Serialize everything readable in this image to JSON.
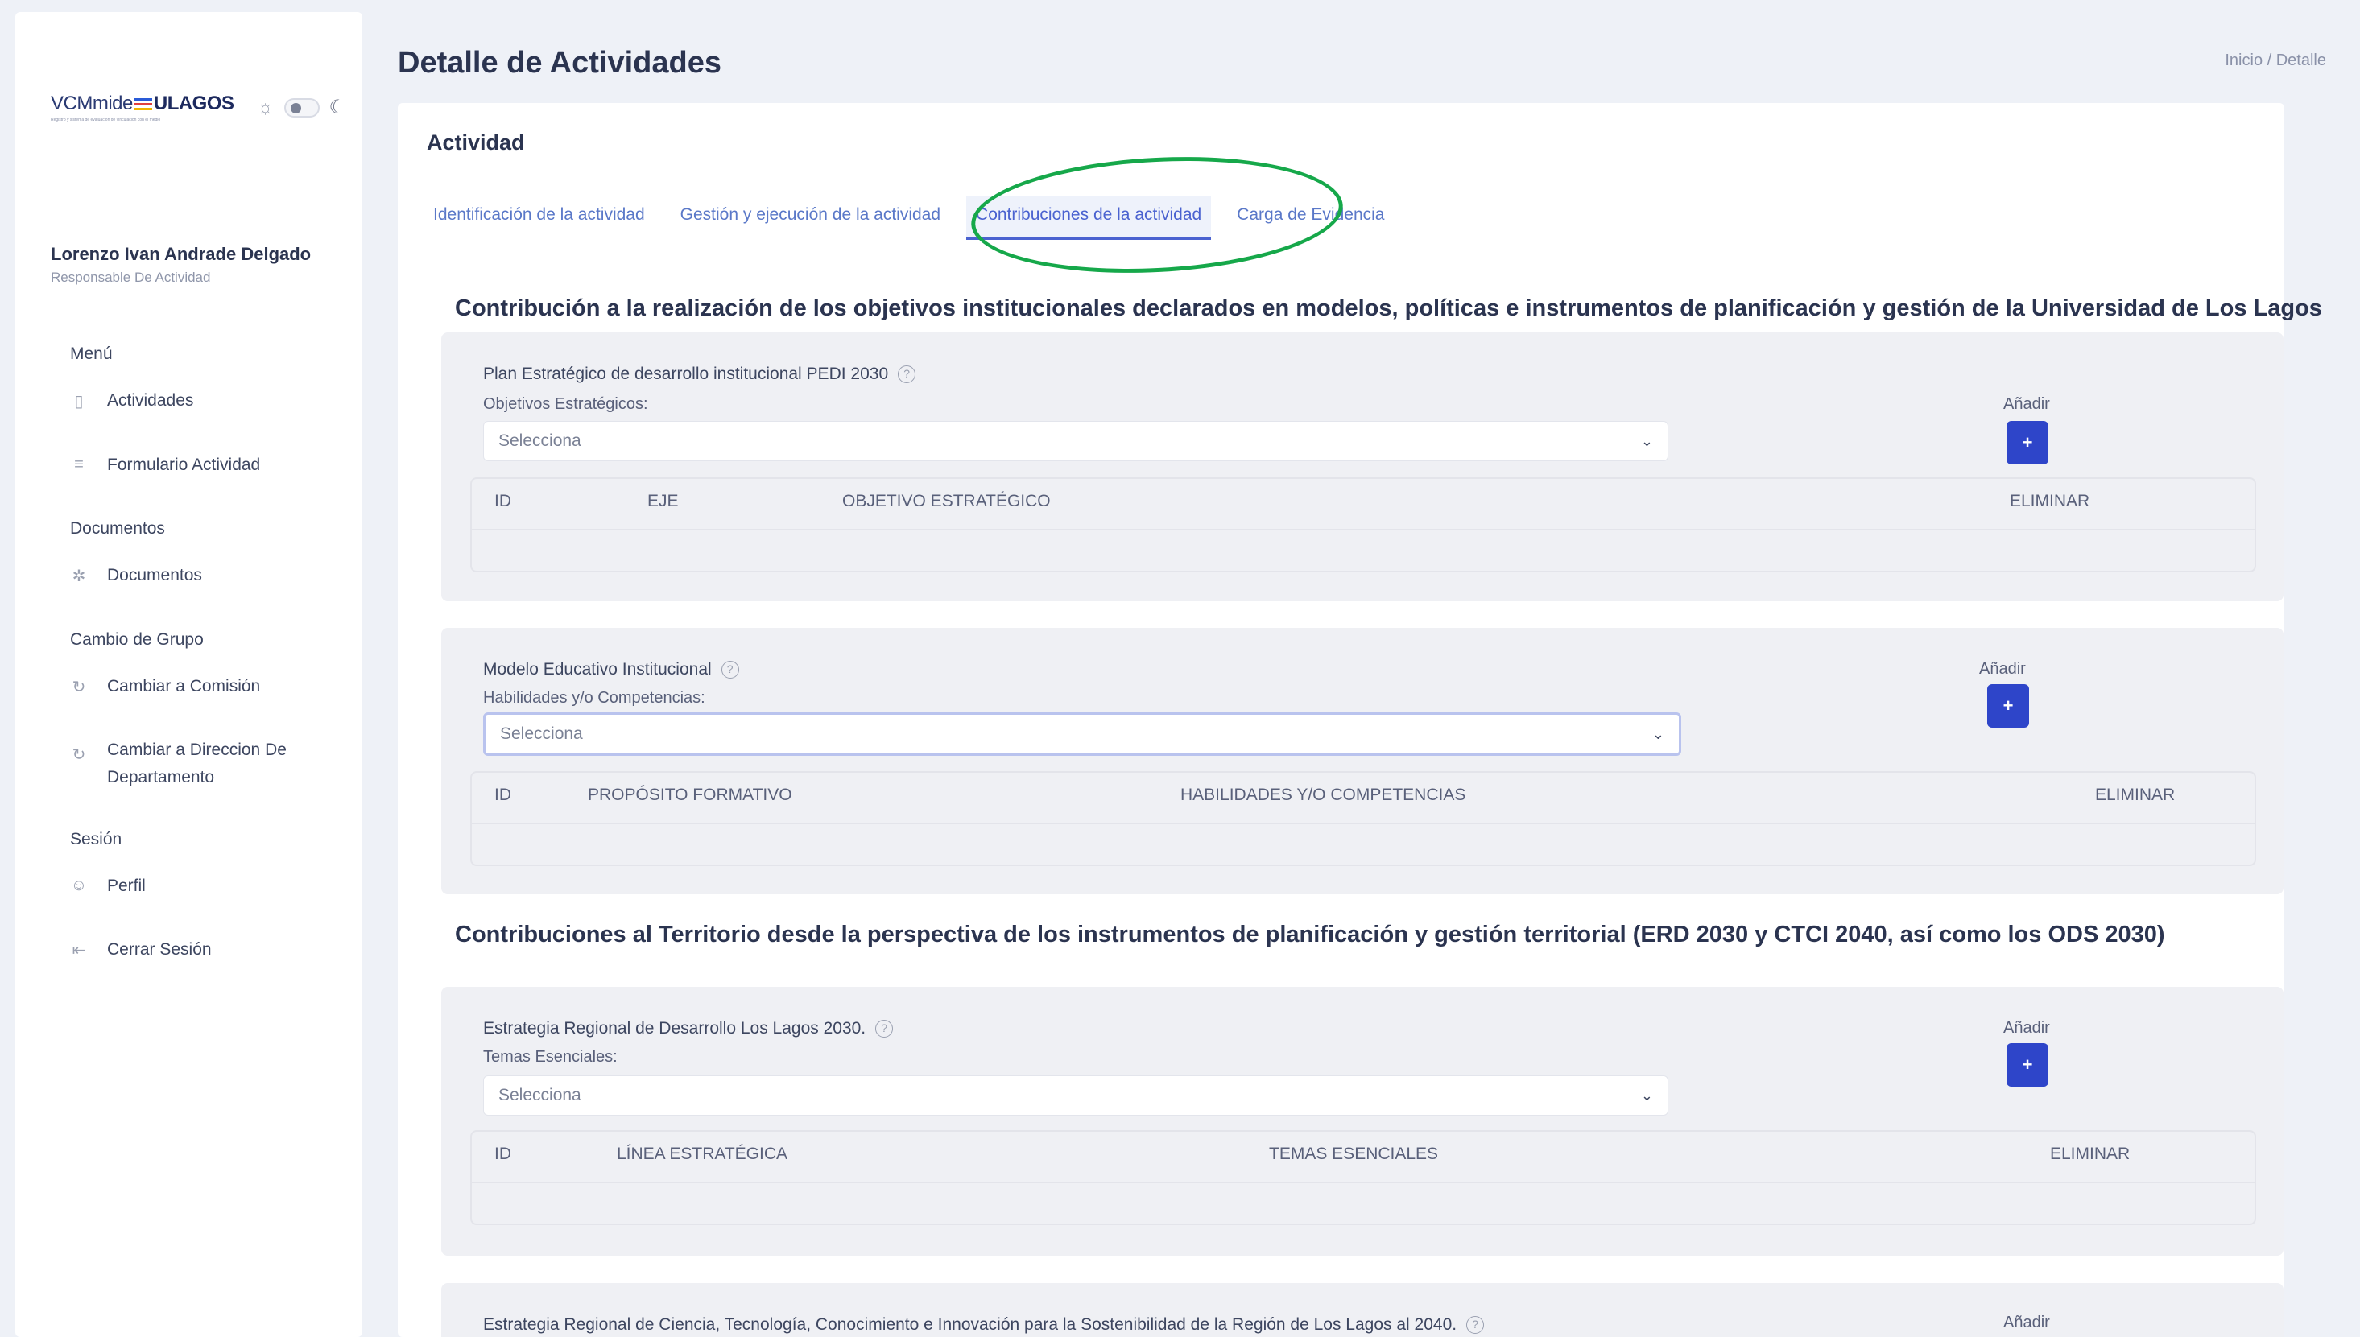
{
  "app": {
    "logo_text": "VCMmide",
    "logo_brand": "ULAGOS",
    "logo_tagline": "Registro y sistema de evaluación de vinculación con el medio"
  },
  "user": {
    "name": "Lorenzo Ivan Andrade Delgado",
    "role": "Responsable De Actividad"
  },
  "sidebar": {
    "sections": [
      {
        "title": "Menú",
        "items": [
          {
            "label": "Actividades",
            "icon": "clipboard-icon"
          },
          {
            "label": "Formulario Actividad",
            "icon": "list-icon"
          }
        ]
      },
      {
        "title": "Documentos",
        "items": [
          {
            "label": "Documentos",
            "icon": "life-ring-icon"
          }
        ]
      },
      {
        "title": "Cambio de Grupo",
        "items": [
          {
            "label": "Cambiar a Comisión",
            "icon": "refresh-icon"
          },
          {
            "label": "Cambiar a Direccion De Departamento",
            "icon": "refresh-icon"
          }
        ]
      },
      {
        "title": "Sesión",
        "items": [
          {
            "label": "Perfil",
            "icon": "user-circle-icon"
          },
          {
            "label": "Cerrar Sesión",
            "icon": "logout-icon"
          }
        ]
      }
    ]
  },
  "header": {
    "title": "Detalle de Actividades",
    "breadcrumb": "Inicio / Detalle"
  },
  "card": {
    "title": "Actividad",
    "tabs": [
      {
        "label": "Identificación de la actividad",
        "active": false
      },
      {
        "label": "Gestión y ejecución de la actividad",
        "active": false
      },
      {
        "label": "Contribuciones de la actividad",
        "active": true
      },
      {
        "label": "Carga de Evidencia",
        "active": false
      }
    ]
  },
  "sections": {
    "institutional_heading": "Contribución a la realización de los objetivos institucionales declarados en modelos, políticas e instrumentos de planificación y gestión de la Universidad de Los Lagos",
    "territorial_heading": "Contribuciones al Territorio desde la perspectiva de los instrumentos de planificación y gestión territorial (ERD 2030 y CTCI 2040, así como los ODS 2030)"
  },
  "panels": {
    "pedi": {
      "label": "Plan Estratégico de desarrollo institucional PEDI 2030",
      "sub": "Objetivos Estratégicos:",
      "select": "Selecciona",
      "add": "Añadir",
      "columns": [
        "ID",
        "EJE",
        "OBJETIVO ESTRATÉGICO",
        "ELIMINAR"
      ]
    },
    "modelo": {
      "label": "Modelo Educativo Institucional",
      "sub": "Habilidades y/o Competencias:",
      "select": "Selecciona",
      "add": "Añadir",
      "columns": [
        "ID",
        "PROPÓSITO FORMATIVO",
        "HABILIDADES Y/O COMPETENCIAS",
        "ELIMINAR"
      ]
    },
    "erd": {
      "label": "Estrategia Regional de Desarrollo Los Lagos 2030.",
      "sub": "Temas Esenciales:",
      "select": "Selecciona",
      "add": "Añadir",
      "columns": [
        "ID",
        "LÍNEA ESTRATÉGICA",
        "TEMAS ESENCIALES",
        "ELIMINAR"
      ]
    },
    "ctci": {
      "label": "Estrategia Regional de Ciencia, Tecnología, Conocimiento e Innovación para la Sostenibilidad de la Región de Los Lagos al 2040.",
      "add": "Añadir"
    }
  },
  "colors": {
    "accent": "#2e45c9",
    "annotation": "#16a84a"
  }
}
